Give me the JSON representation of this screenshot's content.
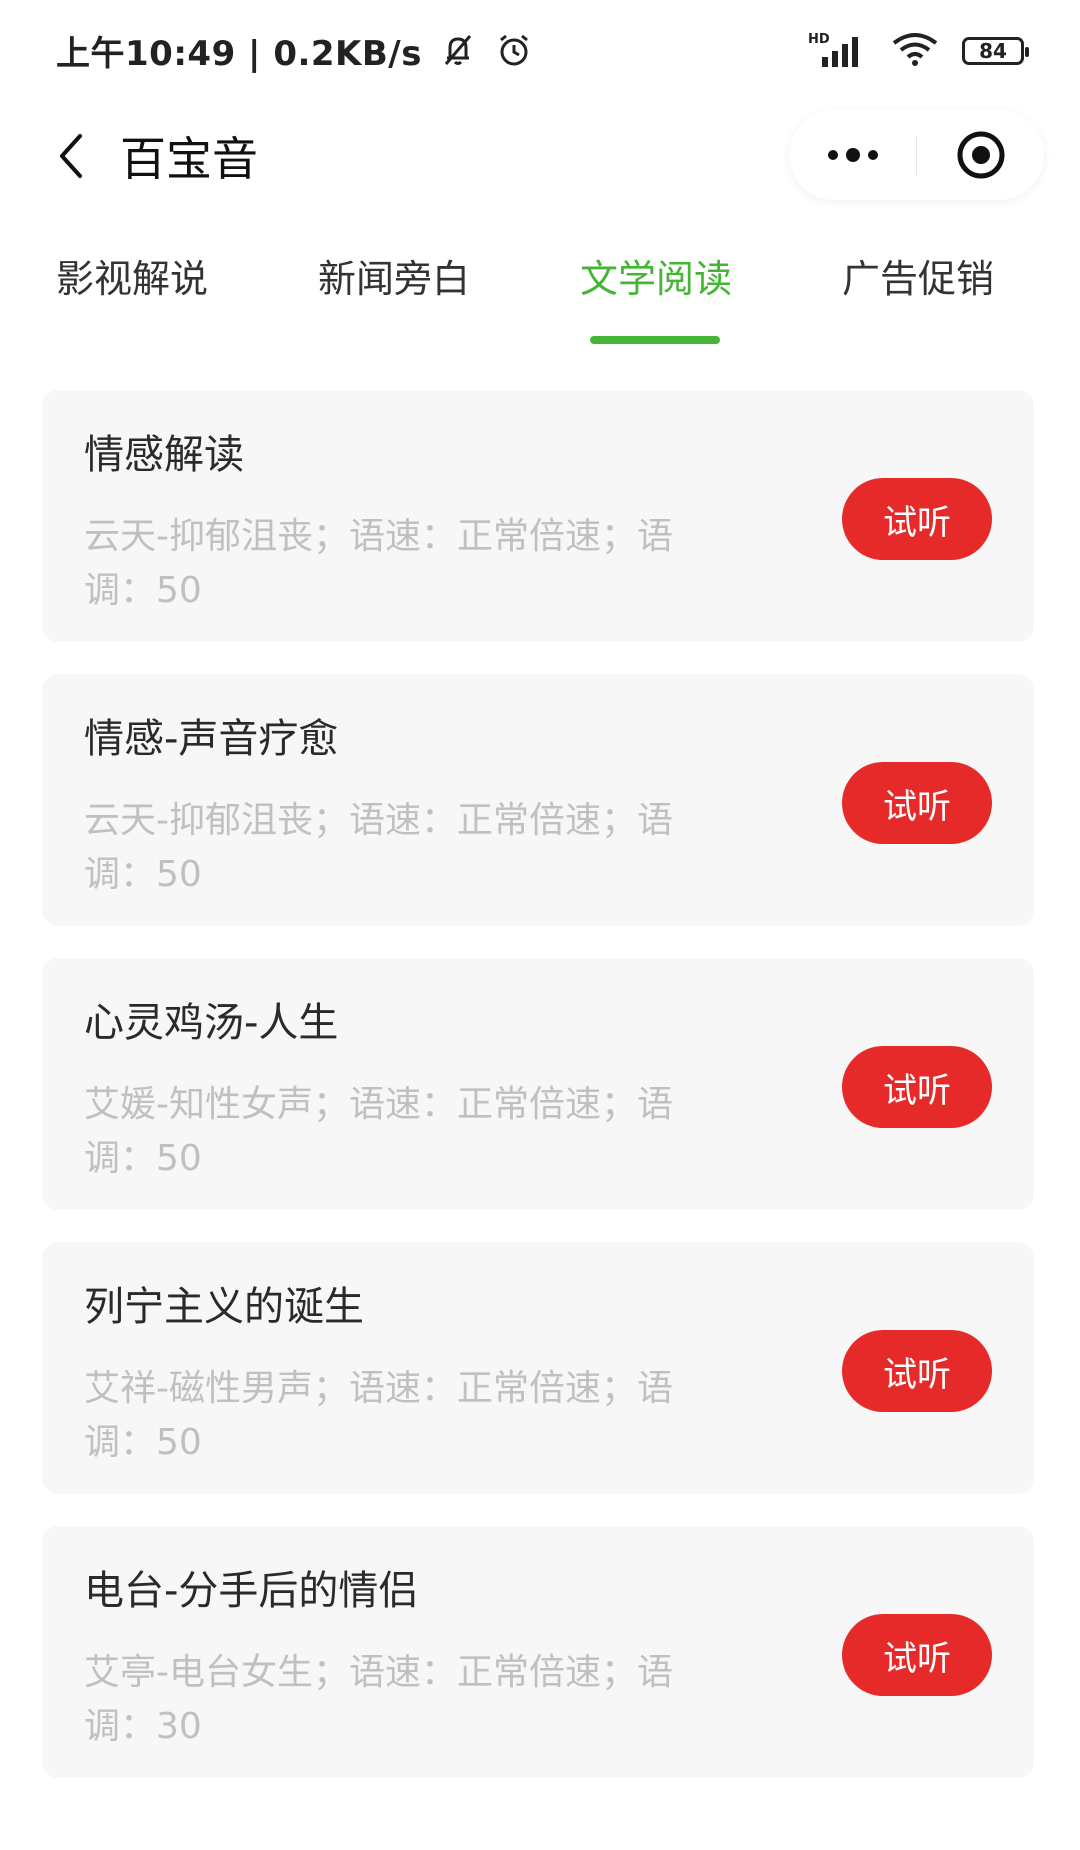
{
  "status_bar": {
    "time_speed": "上午10:49 | 0.2KB/s",
    "icons": [
      "bell-off-icon",
      "alarm-icon",
      "hd-signal-icon",
      "wifi-icon"
    ],
    "network_label": "HD",
    "battery": "84"
  },
  "nav": {
    "title": "百宝音",
    "back_icon": "chevron-left-icon",
    "more_icon": "more-dots-icon",
    "close_icon": "target-circle-icon"
  },
  "tabs": [
    {
      "label": "影视解说",
      "active": false
    },
    {
      "label": "新闻旁白",
      "active": false
    },
    {
      "label": "文学阅读",
      "active": true
    },
    {
      "label": "广告促销",
      "active": false
    }
  ],
  "accent_color": "#44b535",
  "button_color": "#e62a2a",
  "items": [
    {
      "title": "情感解读",
      "desc": "云天-抑郁沮丧；语速：正常倍速；语调：50",
      "button": "试听"
    },
    {
      "title": "情感-声音疗愈",
      "desc": "云天-抑郁沮丧；语速：正常倍速；语调：50",
      "button": "试听"
    },
    {
      "title": "心灵鸡汤-人生",
      "desc": "艾媛-知性女声；语速：正常倍速；语调：50",
      "button": "试听"
    },
    {
      "title": "列宁主义的诞生",
      "desc": "艾祥-磁性男声；语速：正常倍速；语调：50",
      "button": "试听"
    },
    {
      "title": "电台-分手后的情侣",
      "desc": "艾亭-电台女生；语速：正常倍速；语调：30",
      "button": "试听"
    }
  ]
}
